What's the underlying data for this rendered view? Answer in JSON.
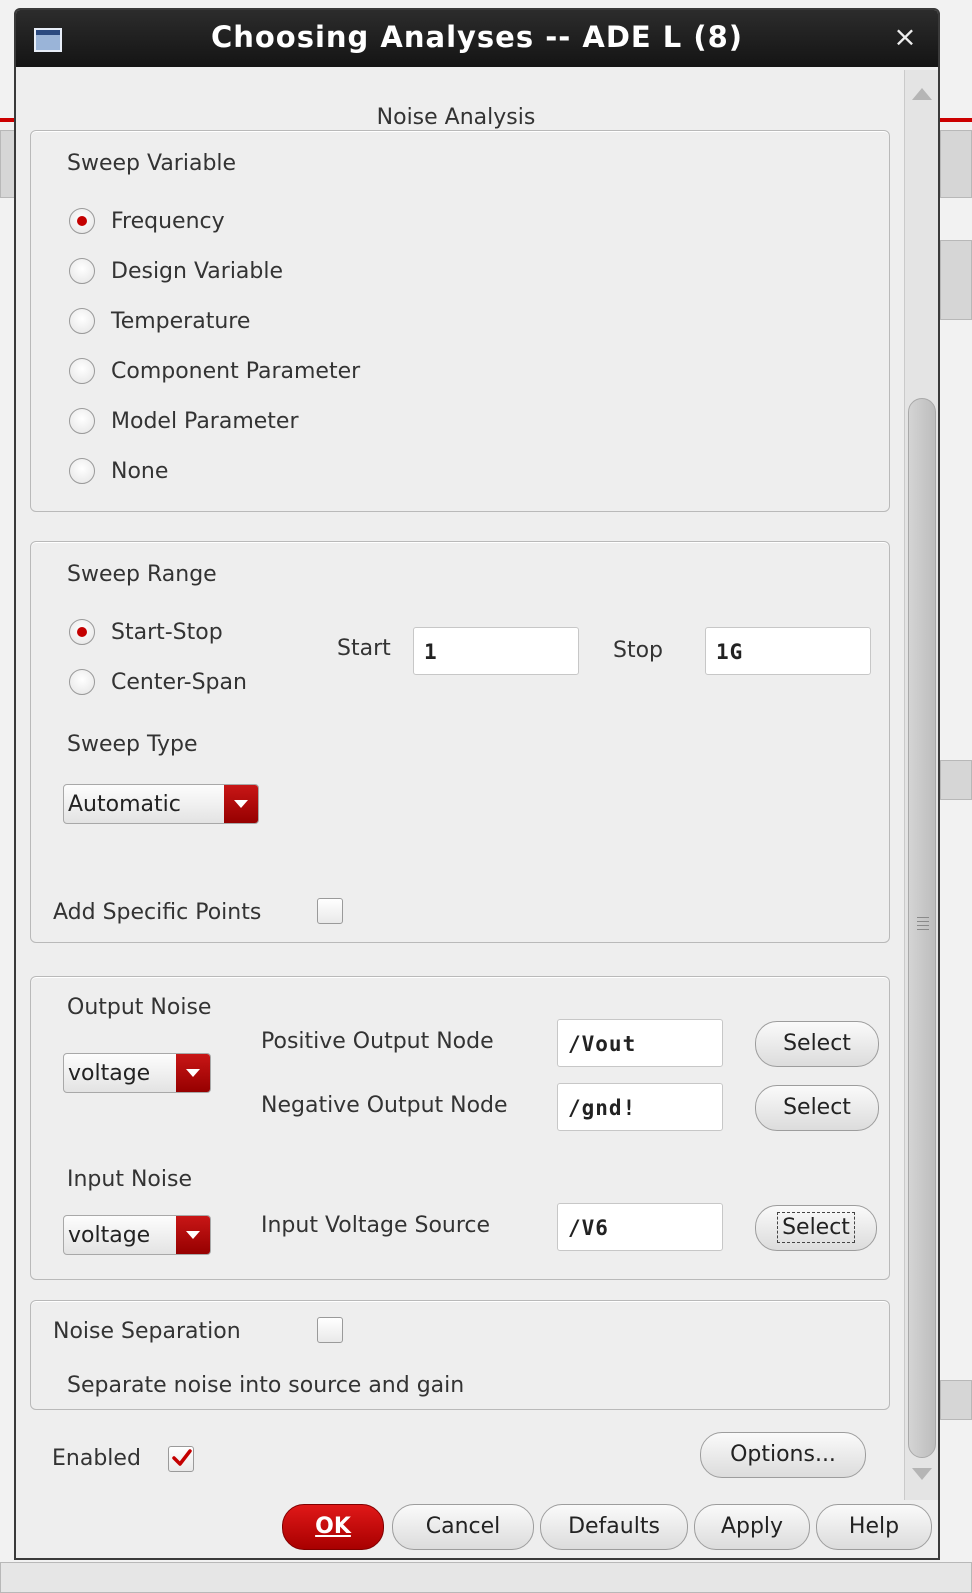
{
  "window": {
    "title": "Choosing Analyses -- ADE L (8)",
    "close_glyph": "×"
  },
  "heading": "Noise Analysis",
  "sweep_variable": {
    "label": "Sweep Variable",
    "options": [
      "Frequency",
      "Design Variable",
      "Temperature",
      "Component Parameter",
      "Model Parameter",
      "None"
    ],
    "selected": "Frequency"
  },
  "sweep_range": {
    "label": "Sweep Range",
    "options": [
      "Start-Stop",
      "Center-Span"
    ],
    "selected": "Start-Stop",
    "start_label": "Start",
    "start_value": "1",
    "stop_label": "Stop",
    "stop_value": "1G",
    "sweep_type_label": "Sweep Type",
    "sweep_type_value": "Automatic",
    "add_points_label": "Add Specific Points",
    "add_points_checked": false
  },
  "output_noise": {
    "label": "Output Noise",
    "type_value": "voltage",
    "pos_node_label": "Positive Output Node",
    "pos_node_value": "/Vout",
    "neg_node_label": "Negative Output Node",
    "neg_node_value": "/gnd!",
    "select_label": "Select"
  },
  "input_noise": {
    "label": "Input Noise",
    "type_value": "voltage",
    "source_label": "Input Voltage Source",
    "source_value": "/V6",
    "select_label": "Select"
  },
  "noise_separation": {
    "label": "Noise Separation",
    "checked": false,
    "description": "Separate noise into source and gain"
  },
  "enabled": {
    "label": "Enabled",
    "checked": true
  },
  "buttons": {
    "options": "Options...",
    "ok": "OK",
    "cancel": "Cancel",
    "defaults": "Defaults",
    "apply": "Apply",
    "help": "Help"
  },
  "colors": {
    "accent": "#c40000",
    "titlebar": "#1c1c1c",
    "dialog_bg": "#eeeeee"
  }
}
